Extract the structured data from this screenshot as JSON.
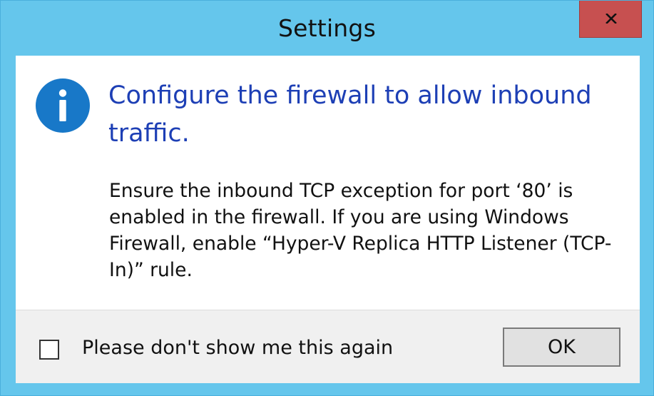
{
  "window": {
    "title": "Settings",
    "accent_color": "#65c6ec",
    "close_button": {
      "icon": "close-icon",
      "color": "#c75050"
    }
  },
  "message": {
    "icon": "info-icon",
    "icon_color": "#1878c8",
    "heading": "Configure the firewall to allow inbound traffic.",
    "heading_color": "#1d3fb5",
    "body": "Ensure the inbound TCP exception for port ‘80’ is enabled in the firewall. If you are using Windows Firewall, enable “Hyper-V Replica HTTP Listener (TCP-In)” rule."
  },
  "footer": {
    "checkbox_label": "Please don't show me this again",
    "checkbox_checked": false,
    "ok_label": "OK"
  }
}
